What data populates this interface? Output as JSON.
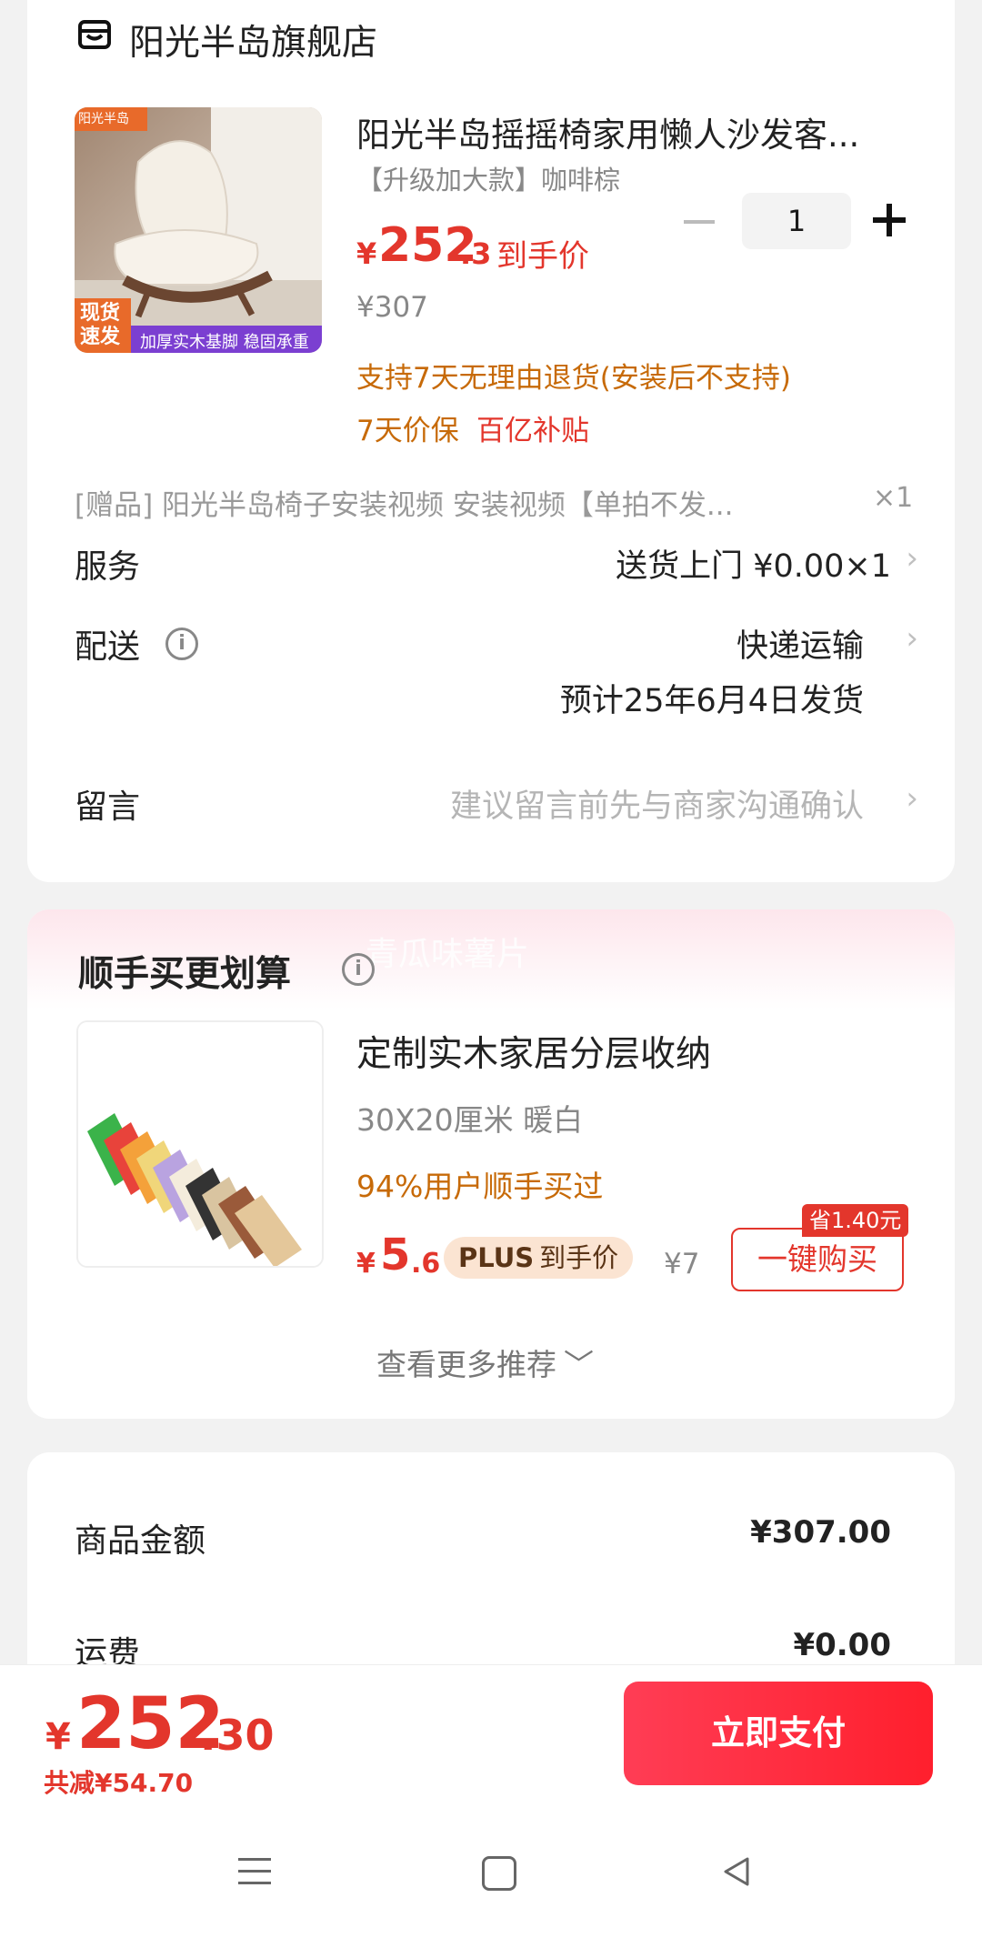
{
  "store": {
    "name": "阳光半岛旗舰店"
  },
  "product": {
    "image_badge_top": "阳光半岛",
    "image_badge_stock": "现货速发",
    "image_caption": "加厚实木基脚 稳固承重",
    "title": "阳光半岛摇摇椅家用懒人沙发客...",
    "spec": "【升级加大款】咖啡棕",
    "price_currency": "¥",
    "price_int": "252",
    "price_dec": ".3",
    "price_label": "到手价",
    "original_price": "¥307",
    "quantity": "1",
    "return_policy": "支持7天无理由退货(安装后不支持)",
    "tags": [
      "7天价保",
      "百亿补贴"
    ]
  },
  "gift": {
    "text": "[赠品]  阳光半岛椅子安装视频 安装视频【单拍不发...",
    "qty": "×1"
  },
  "service": {
    "label": "服务",
    "value": "送货上门  ¥0.00×1"
  },
  "delivery": {
    "label": "配送",
    "method": "快递运输",
    "estimate": "预计25年6月4日发货"
  },
  "message": {
    "label": "留言",
    "placeholder": "建议留言前先与商家沟通确认"
  },
  "recommend": {
    "watermark": "青瓜味薯片",
    "title": "顺手买更划算",
    "item": {
      "name": "定制实木家居分层收纳",
      "spec": "30X20厘米 暖白",
      "users": "94%用户顺手买过",
      "price_currency": "¥",
      "price_int": "5",
      "price_dec": ".6",
      "plus_label": "PLUS",
      "plus_suffix": "到手价",
      "original_price": "¥7",
      "save_badge": "省1.40元",
      "buy_label": "一键购买"
    },
    "more_label": "查看更多推荐"
  },
  "summary": {
    "rows": [
      {
        "label": "商品金额",
        "value": "¥307.00"
      },
      {
        "label": "运费",
        "value": "¥0.00"
      }
    ]
  },
  "footer": {
    "total_currency": "¥",
    "total_int": "252",
    "total_dec": ".30",
    "total_saved": "共减¥54.70",
    "pay_label": "立即支付"
  },
  "nav": {
    "icons": [
      "menu-icon",
      "home-icon",
      "back-icon"
    ]
  }
}
